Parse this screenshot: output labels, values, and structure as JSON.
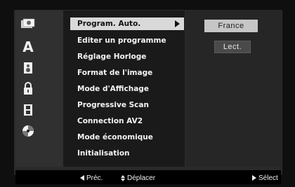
{
  "menu": {
    "items": [
      {
        "label": "Program. Auto.",
        "selected": true
      },
      {
        "label": "Editer un programme",
        "selected": false
      },
      {
        "label": "Réglage Horloge",
        "selected": false
      },
      {
        "label": "Format de l'image",
        "selected": false
      },
      {
        "label": "Mode d'Affichage",
        "selected": false
      },
      {
        "label": "Progressive Scan",
        "selected": false
      },
      {
        "label": "Connection AV2",
        "selected": false
      },
      {
        "label": "Mode économique",
        "selected": false
      },
      {
        "label": "Initialisation",
        "selected": false
      }
    ]
  },
  "options": {
    "country": "France",
    "action": "Lect."
  },
  "sidebar": {
    "icons": [
      "disc-settings-icon",
      "language-a-icon",
      "audio-speaker-icon",
      "lock-icon",
      "film-icon",
      "disc-icon"
    ]
  },
  "footer": {
    "prev_label": "Préc.",
    "move_label": "Déplacer",
    "select_label": "Sélect"
  },
  "colors": {
    "background": "#0f0f0f",
    "menu_panel": "#1a1a1a",
    "highlight": "#d9d9d9",
    "text": "#f4f4f4"
  }
}
